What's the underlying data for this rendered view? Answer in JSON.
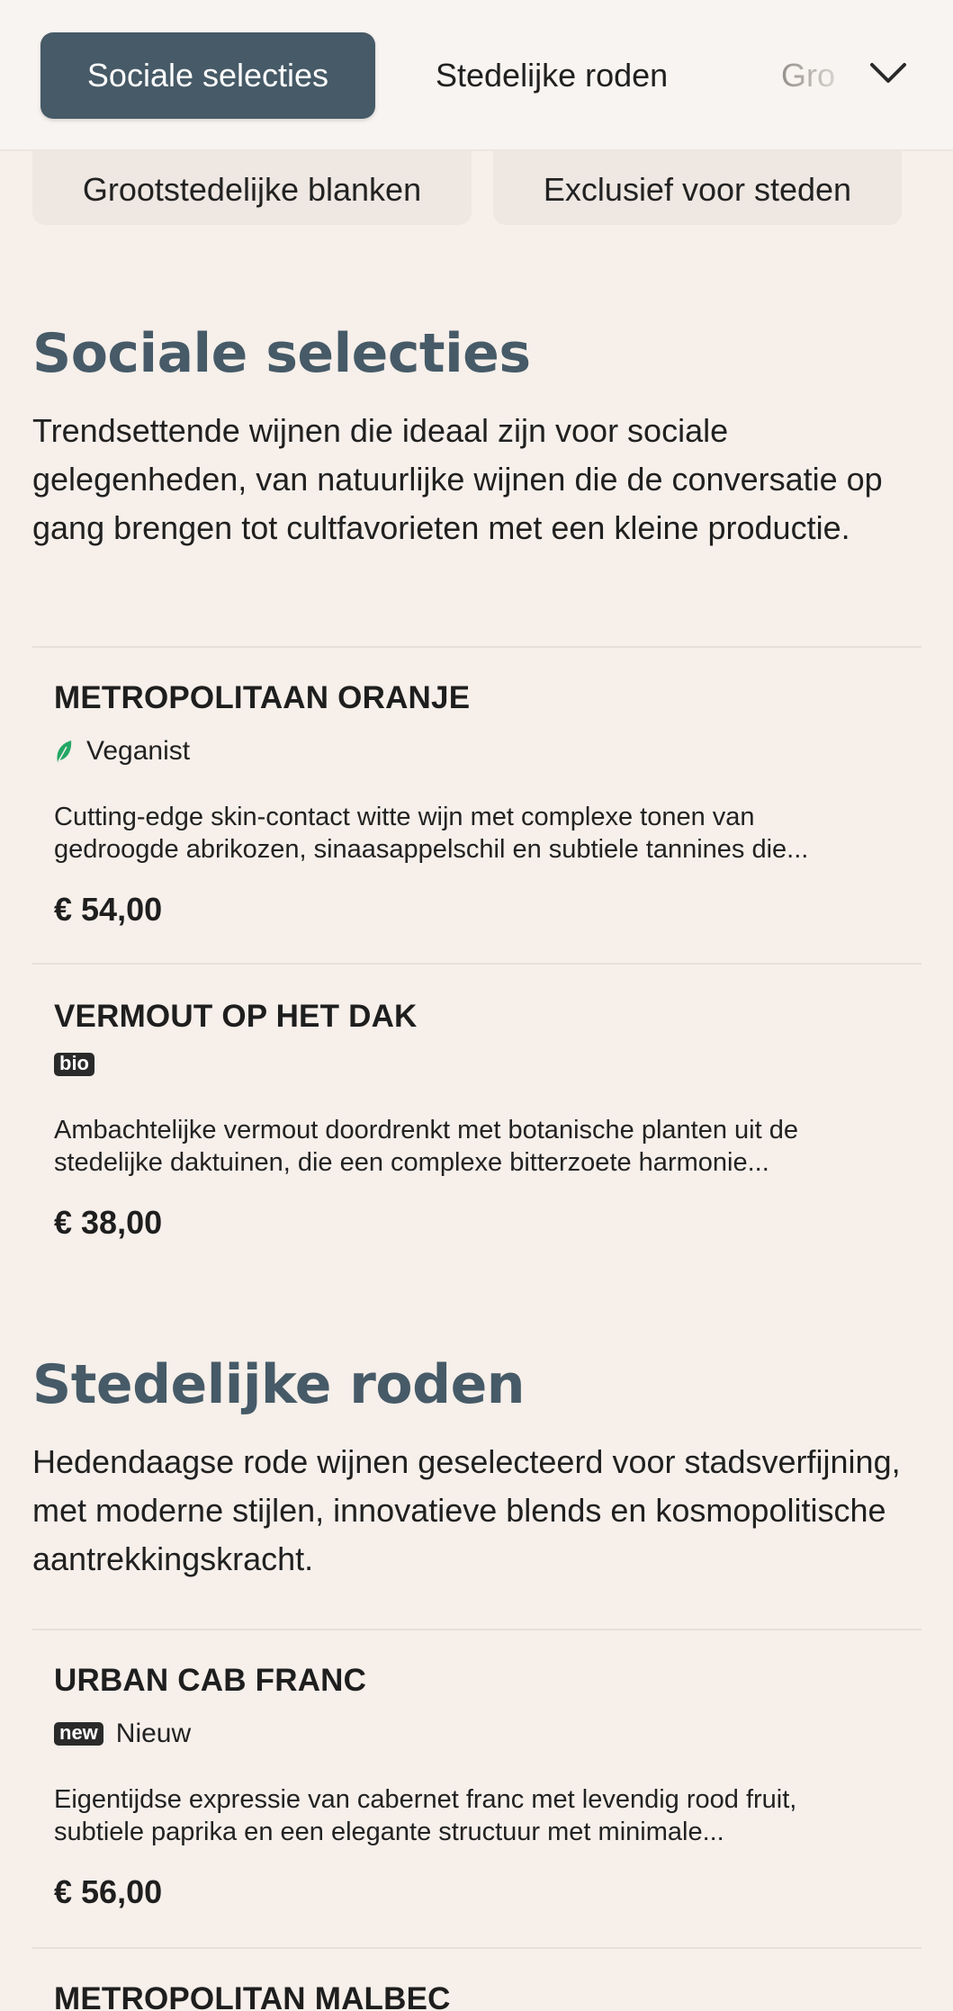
{
  "nav": {
    "tabs": [
      {
        "label": "Sociale selecties",
        "active": true
      },
      {
        "label": "Stedelijke roden",
        "active": false
      },
      {
        "label": "Grootstedelijke blanken",
        "active": false
      }
    ],
    "faded_tab_label": "Gro",
    "expand_icon": "chevron-down-icon",
    "pills": [
      {
        "label": "Grootstedelijke blanken"
      },
      {
        "label": "Exclusief voor steden"
      }
    ]
  },
  "sections": [
    {
      "title": "Sociale selecties",
      "description": "Trendsettende wijnen die ideaal zijn voor sociale gelegenheden, van natuurlijke wijnen die de conversatie op gang brengen tot cultfavorieten met een kleine productie.",
      "items": [
        {
          "name": "METROPOLITAAN ORANJE",
          "badge_icon": "leaf-icon",
          "badge_label": "Veganist",
          "description_line1": "Cutting-edge skin-contact witte wijn met complexe tonen van",
          "description_line2": "gedroogde abrikozen, sinaasappelschil en subtiele tannines die...",
          "price": "€ 54,00"
        },
        {
          "name": "VERMOUT OP HET DAK",
          "tag": "bio",
          "description_line1": "Ambachtelijke vermout doordrenkt met botanische planten uit de",
          "description_line2": "stedelijke daktuinen, die een complexe bitterzoete harmonie...",
          "price": "€ 38,00"
        }
      ]
    },
    {
      "title": "Stedelijke roden",
      "description": "Hedendaagse rode wijnen geselecteerd voor stadsverfijning, met moderne stijlen, innovatieve blends en kosmopolitische aantrekkingskracht.",
      "items": [
        {
          "name": "URBAN CAB FRANC",
          "tag": "new",
          "badge_label": "Nieuw",
          "description_line1": "Eigentijdse expressie van cabernet franc met levendig rood fruit,",
          "description_line2": "subtiele paprika en een elegante structuur met minimale...",
          "price": "€ 56,00"
        },
        {
          "name": "METROPOLITAN MALBEC"
        }
      ]
    }
  ],
  "colors": {
    "background": "#F6EFEA",
    "accent": "#465A67",
    "vegan_leaf": "#22A765"
  }
}
